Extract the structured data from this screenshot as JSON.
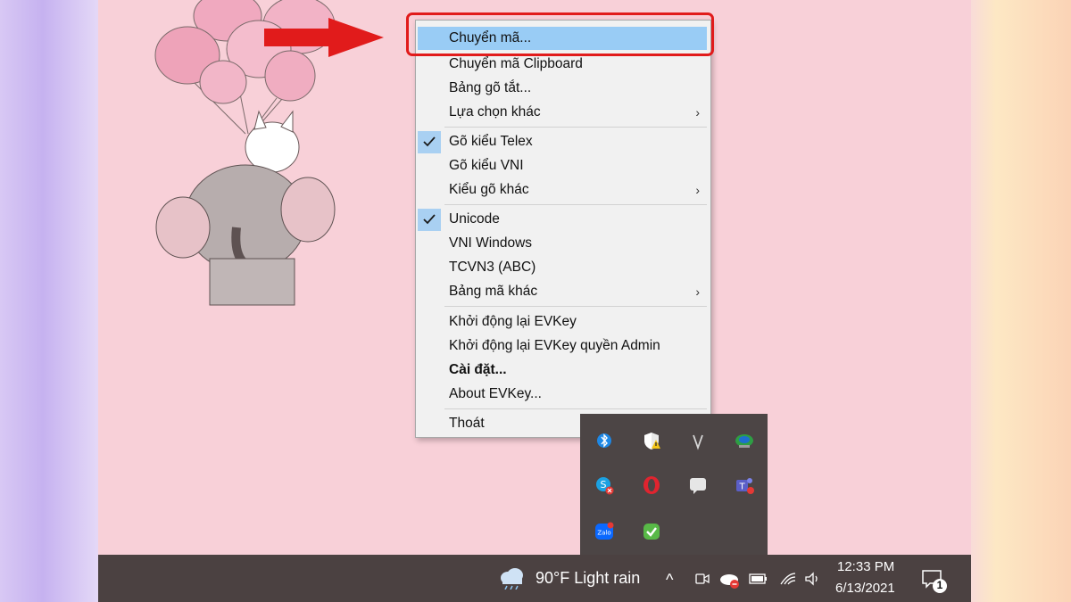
{
  "menu": {
    "items": [
      {
        "label": "Chuyển mã...",
        "highlighted": true
      },
      {
        "label": "Chuyển mã Clipboard"
      },
      {
        "label": "Bảng gõ tắt..."
      },
      {
        "label": "Lựa chọn khác",
        "submenu": true
      },
      {
        "label": "Gõ kiểu Telex",
        "checked": true
      },
      {
        "label": "Gõ kiểu VNI"
      },
      {
        "label": "Kiểu gõ khác",
        "submenu": true
      },
      {
        "label": "Unicode",
        "checked": true
      },
      {
        "label": "VNI Windows"
      },
      {
        "label": "TCVN3 (ABC)"
      },
      {
        "label": "Bảng mã khác",
        "submenu": true
      },
      {
        "label": "Khởi động lại EVKey"
      },
      {
        "label": "Khởi động lại EVKey quyền Admin"
      },
      {
        "label": "Cài đặt...",
        "bold": true
      },
      {
        "label": "About EVKey..."
      },
      {
        "label": "Thoát"
      }
    ],
    "submenu_arrow": "›"
  },
  "tray_icons": [
    "bluetooth-icon",
    "security-warning-icon",
    "vpn-icon",
    "network-globe-icon",
    "skype-icon",
    "opera-icon",
    "chat-bubble-icon",
    "teams-icon",
    "zalo-icon",
    "evkey-check-icon"
  ],
  "taskbar": {
    "weather": "90°F  Light rain",
    "time": "12:33 PM",
    "date": "6/13/2021",
    "notification_count": "1",
    "chevron": "^"
  },
  "colors": {
    "highlight": "#99ccf5",
    "callout_red": "#e11b1b",
    "taskbar_bg": "#4b4141",
    "desktop_bg": "#f8d0d8"
  }
}
